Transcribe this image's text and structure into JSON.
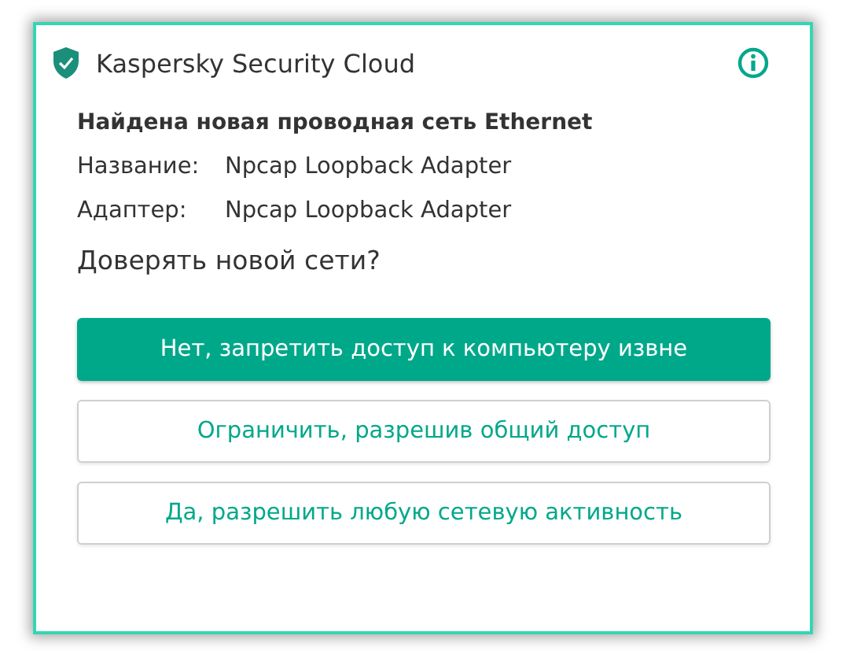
{
  "window": {
    "title": "Kaspersky Security Cloud"
  },
  "heading": "Найдена новая проводная сеть Ethernet",
  "details": [
    {
      "label": "Название:",
      "value": "Npcap Loopback Adapter"
    },
    {
      "label": "Адаптер:",
      "value": "Npcap Loopback Adapter"
    }
  ],
  "question": "Доверять новой сети?",
  "buttons": [
    {
      "label": "Нет, запретить доступ к компьютеру извне",
      "kind": "primary"
    },
    {
      "label": "Ограничить, разрешив общий доступ",
      "kind": "secondary"
    },
    {
      "label": "Да, разрешить любую сетевую активность",
      "kind": "secondary"
    }
  ]
}
